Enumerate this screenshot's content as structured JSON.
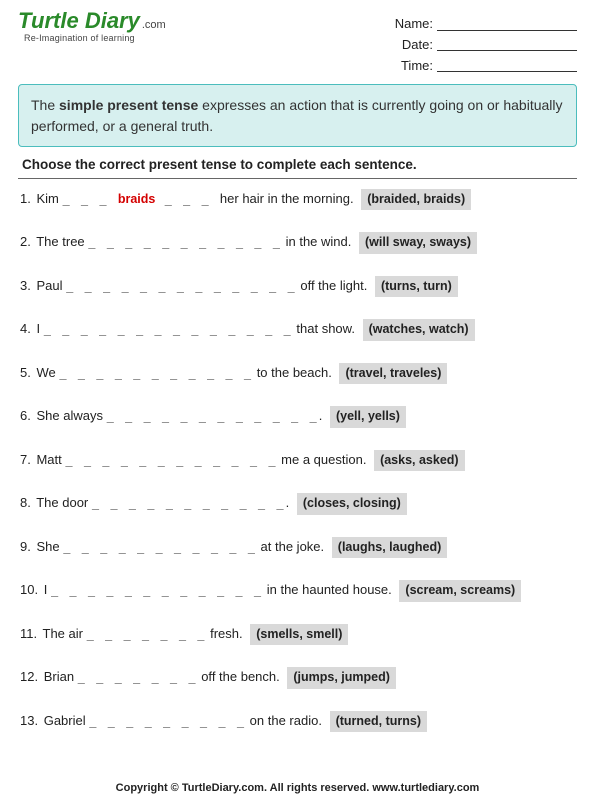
{
  "logo": {
    "main": "Turtle Diary",
    "dotcom": ".com",
    "tagline": "Re-Imagination of learning"
  },
  "info": {
    "name_label": "Name:",
    "date_label": "Date:",
    "time_label": "Time:"
  },
  "definition": {
    "prefix": "The ",
    "term": "simple present tense",
    "suffix": " expresses an action that is currently going on or habitually performed, or a general truth."
  },
  "instruction": "Choose the correct present tense to complete each sentence.",
  "questions": [
    {
      "n": "1.",
      "before": "Kim ",
      "blank": "_ _ _  ",
      "example": "braids",
      "blank2": " _ _ _ ",
      "after": " her hair in the morning.",
      "options": "(braided, braids)"
    },
    {
      "n": "2.",
      "before": "The tree ",
      "blank": "_ _ _ _ _ _ _ _ _ _ _",
      "after": " in the wind.",
      "options": "(will sway, sways)"
    },
    {
      "n": "3.",
      "before": "Paul ",
      "blank": "_ _ _ _ _ _ _ _ _ _ _ _ _",
      "after": " off the light.",
      "options": "(turns, turn)"
    },
    {
      "n": "4.",
      "before": "I ",
      "blank": "_ _ _ _ _ _ _ _ _ _ _ _ _ _",
      "after": " that show.",
      "options": "(watches, watch)"
    },
    {
      "n": "5.",
      "before": "We ",
      "blank": "_ _ _ _ _ _ _ _ _ _ _",
      "after": " to the beach.",
      "options": "(travel, traveles)"
    },
    {
      "n": "6.",
      "before": "She always ",
      "blank": "_ _ _ _ _ _ _ _ _ _ _ _",
      "after": ".",
      "options": "(yell, yells)"
    },
    {
      "n": "7.",
      "before": "Matt ",
      "blank": "_ _ _ _ _ _ _ _ _ _ _ _",
      "after": " me a question.",
      "options": "(asks, asked)"
    },
    {
      "n": "8.",
      "before": "The door ",
      "blank": "_ _ _ _ _ _ _ _ _ _ _",
      "after": ".",
      "options": "(closes, closing)"
    },
    {
      "n": "9.",
      "before": "She ",
      "blank": "_ _ _ _ _ _ _ _ _ _ _",
      "after": " at the joke.",
      "options": "(laughs, laughed)"
    },
    {
      "n": "10.",
      "before": "I ",
      "blank": "_ _ _ _ _ _ _ _ _ _ _ _",
      "after": " in the haunted house.",
      "options": "(scream, screams)"
    },
    {
      "n": "11.",
      "before": "The air ",
      "blank": "_ _ _ _ _ _ _",
      "after": " fresh.",
      "options": "(smells, smell)"
    },
    {
      "n": "12.",
      "before": "Brian ",
      "blank": "_ _ _ _ _ _ _",
      "after": " off the bench.",
      "options": "(jumps, jumped)"
    },
    {
      "n": "13.",
      "before": "Gabriel ",
      "blank": "_ _ _ _ _ _ _ _ _",
      "after": " on the radio.",
      "options": "(turned, turns)"
    }
  ],
  "footer": "Copyright © TurtleDiary.com. All rights reserved. www.turtlediary.com"
}
